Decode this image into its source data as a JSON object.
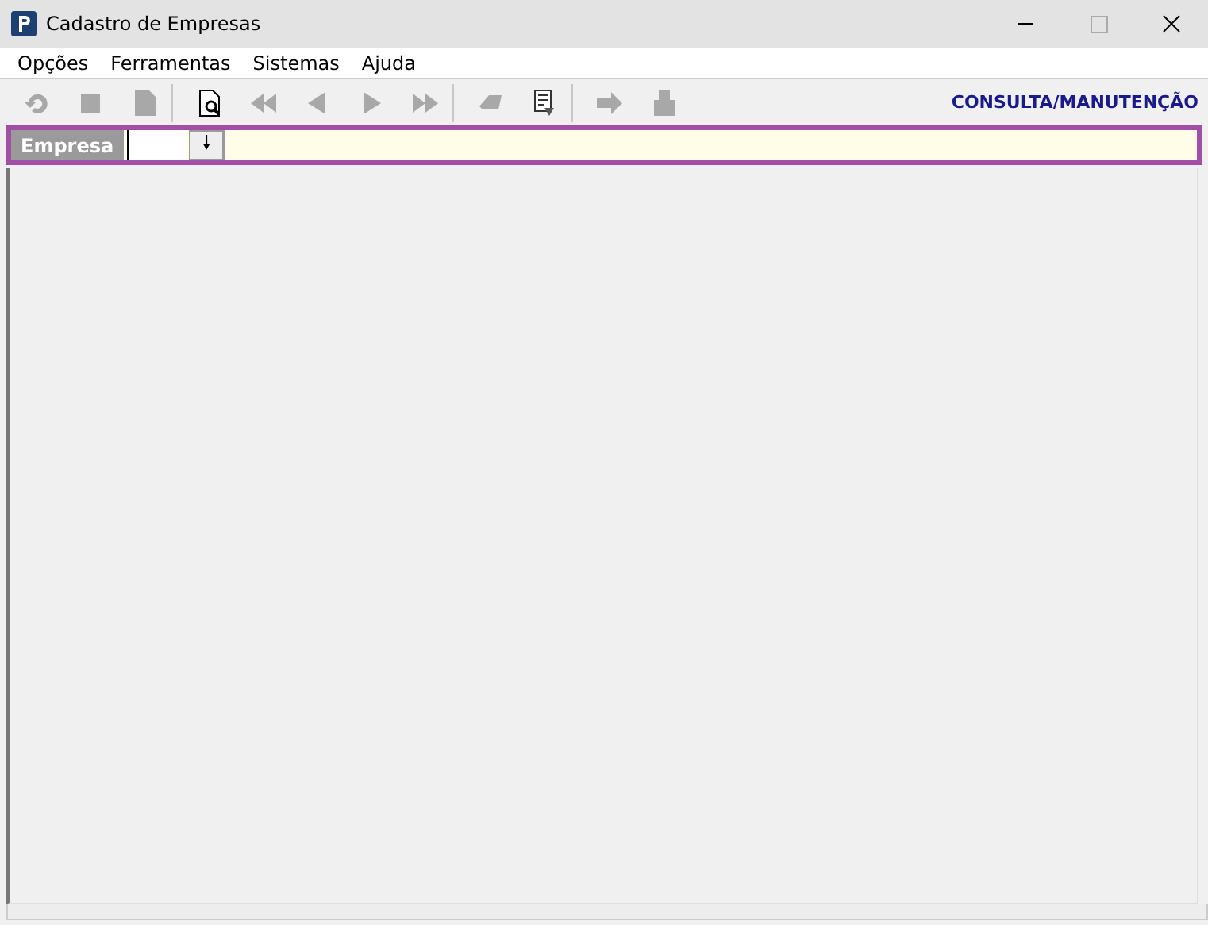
{
  "window": {
    "title": "Cadastro de Empresas"
  },
  "menu": [
    "Opções",
    "Ferramentas",
    "Sistemas",
    "Ajuda"
  ],
  "toolbar": [
    {
      "kind": "undo",
      "disabled": true
    },
    {
      "kind": "stop",
      "disabled": true
    },
    {
      "kind": "document",
      "disabled": true
    },
    {
      "kind": "separator"
    },
    {
      "kind": "preview",
      "disabled": false
    },
    {
      "kind": "first",
      "disabled": true
    },
    {
      "kind": "previous",
      "disabled": true
    },
    {
      "kind": "next",
      "disabled": true
    },
    {
      "kind": "last",
      "disabled": true
    },
    {
      "kind": "separator"
    },
    {
      "kind": "eraser",
      "disabled": true
    },
    {
      "kind": "report",
      "disabled": false
    },
    {
      "kind": "separator"
    },
    {
      "kind": "arrow",
      "disabled": true
    },
    {
      "kind": "stamp",
      "disabled": true
    }
  ],
  "mode": "CONSULTA/MANUTENÇÃO",
  "filter": {
    "label": "Empresa",
    "lookup_icon": "🠗"
  }
}
